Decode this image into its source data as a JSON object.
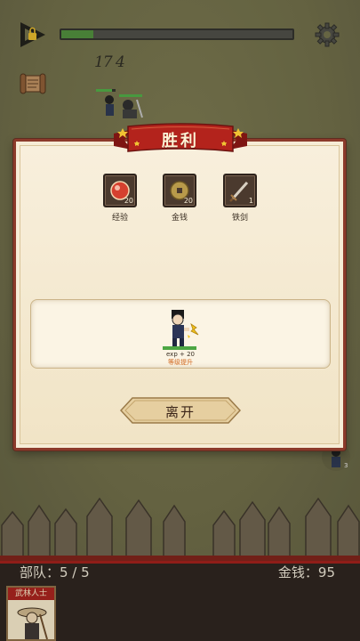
{
  "hud": {
    "play_icon": "play-lock-icon",
    "settings_icon": "gear-icon",
    "quest_icon": "scroll-icon",
    "wave_progress": 0.14,
    "floating_number": "17 4"
  },
  "victory": {
    "title": "胜利",
    "rewards": [
      {
        "label": "经验",
        "count": "20",
        "icon": "exp-orb-icon"
      },
      {
        "label": "金钱",
        "count": "20",
        "icon": "coin-icon"
      },
      {
        "label": "铁剑",
        "count": "1",
        "icon": "iron-sword-icon"
      }
    ],
    "hero": {
      "exp_text": "exp + 20",
      "level_text": "等级提升",
      "hp_fraction": 1.0
    },
    "leave_label": "离开"
  },
  "status": {
    "team_text": "部队：5 / 5",
    "gold_text": "金钱：95"
  },
  "roster": [
    {
      "name": "武林人士"
    }
  ],
  "colors": {
    "accent_red": "#a3201b",
    "panel": "#f6ecd6",
    "progress_green": "#4c8a3a"
  }
}
